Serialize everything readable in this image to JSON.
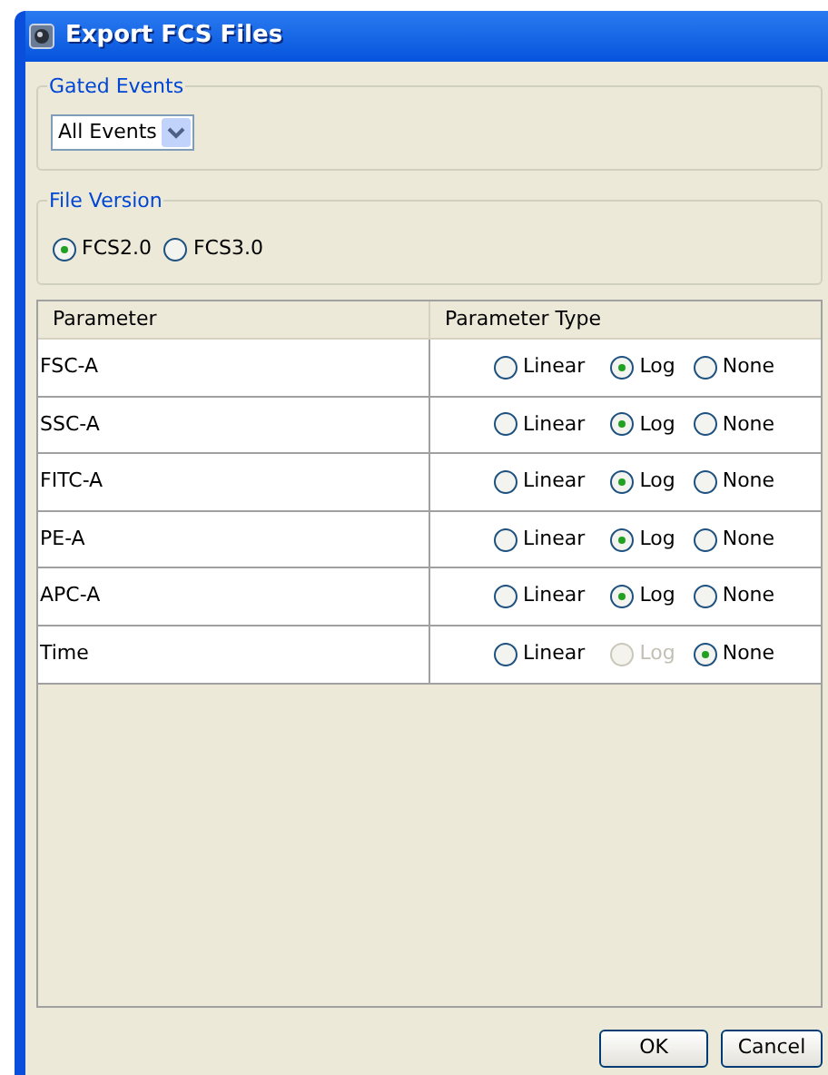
{
  "window": {
    "title": "Export FCS Files"
  },
  "gated_events": {
    "title": "Gated Events",
    "value": "All Events"
  },
  "file_version": {
    "title": "File Version",
    "options": [
      {
        "label": "FCS2.0",
        "selected": true
      },
      {
        "label": "FCS3.0",
        "selected": false
      }
    ]
  },
  "table": {
    "columns": [
      "Parameter",
      "Parameter Type"
    ],
    "rows": [
      {
        "name": "FSC-A",
        "options": [
          {
            "label": "Linear",
            "selected": false,
            "disabled": false
          },
          {
            "label": "Log",
            "selected": true,
            "disabled": false
          },
          {
            "label": "None",
            "selected": false,
            "disabled": false
          }
        ]
      },
      {
        "name": "SSC-A",
        "options": [
          {
            "label": "Linear",
            "selected": false,
            "disabled": false
          },
          {
            "label": "Log",
            "selected": true,
            "disabled": false
          },
          {
            "label": "None",
            "selected": false,
            "disabled": false
          }
        ]
      },
      {
        "name": "FITC-A",
        "options": [
          {
            "label": "Linear",
            "selected": false,
            "disabled": false
          },
          {
            "label": "Log",
            "selected": true,
            "disabled": false
          },
          {
            "label": "None",
            "selected": false,
            "disabled": false
          }
        ]
      },
      {
        "name": "PE-A",
        "options": [
          {
            "label": "Linear",
            "selected": false,
            "disabled": false
          },
          {
            "label": "Log",
            "selected": true,
            "disabled": false
          },
          {
            "label": "None",
            "selected": false,
            "disabled": false
          }
        ]
      },
      {
        "name": "APC-A",
        "options": [
          {
            "label": "Linear",
            "selected": false,
            "disabled": false
          },
          {
            "label": "Log",
            "selected": true,
            "disabled": false
          },
          {
            "label": "None",
            "selected": false,
            "disabled": false
          }
        ]
      },
      {
        "name": "Time",
        "options": [
          {
            "label": "Linear",
            "selected": false,
            "disabled": false
          },
          {
            "label": "Log",
            "selected": false,
            "disabled": true
          },
          {
            "label": "None",
            "selected": true,
            "disabled": false
          }
        ]
      }
    ]
  },
  "buttons": [
    "OK",
    "Cancel"
  ]
}
